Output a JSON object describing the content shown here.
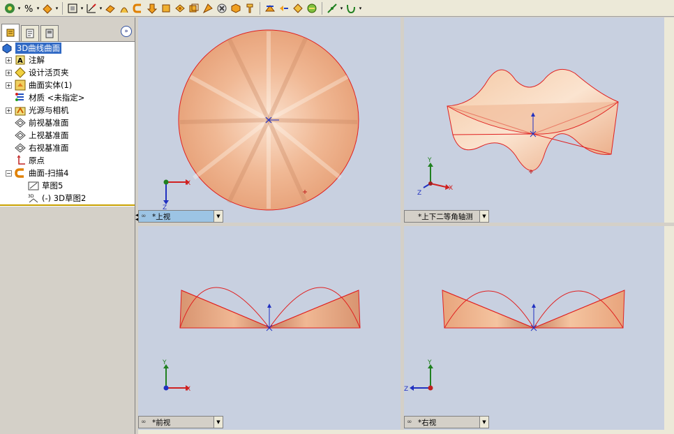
{
  "tree": {
    "root_label": "3D曲线曲面",
    "items": [
      {
        "label": "注解",
        "expander": "+"
      },
      {
        "label": "设计活页夹",
        "expander": "+"
      },
      {
        "label": "曲面实体(1)",
        "expander": "+"
      },
      {
        "label": "材质 <未指定>",
        "expander": ""
      },
      {
        "label": "光源与相机",
        "expander": "+"
      },
      {
        "label": "前视基准面",
        "expander": ""
      },
      {
        "label": "上视基准面",
        "expander": ""
      },
      {
        "label": "右视基准面",
        "expander": ""
      },
      {
        "label": "原点",
        "expander": ""
      },
      {
        "label": "曲面-扫描4",
        "expander": "−"
      }
    ],
    "children": [
      {
        "label": "草图5"
      },
      {
        "label": "(-) 3D草图2"
      }
    ]
  },
  "viewports": {
    "top_left": {
      "label": "*上视"
    },
    "top_right": {
      "label": "*上下二等角轴测"
    },
    "bottom_left": {
      "label": "*前视"
    },
    "bottom_right": {
      "label": "*右视"
    }
  },
  "triad": {
    "x": "X",
    "y": "Y",
    "z": "Z"
  },
  "panel": {
    "collapse_glyph": "»",
    "link_glyph": "∞"
  },
  "colors": {
    "surface": "#f0b890",
    "edge": "#e02020",
    "viewport_bg": "#c8d0e0",
    "selection": "#316ac5"
  }
}
